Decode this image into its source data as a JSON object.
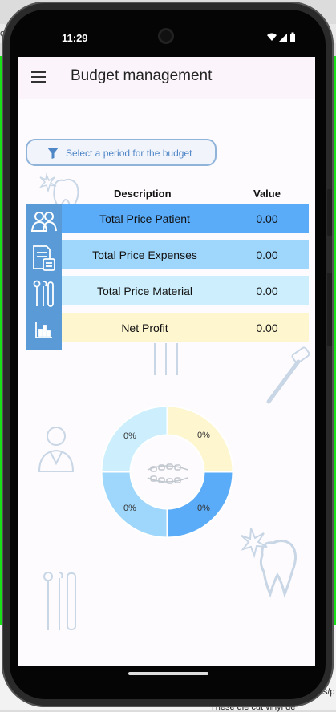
{
  "status_bar": {
    "time": "11:29"
  },
  "app_bar": {
    "title": "Budget management",
    "menu_icon": "hamburger-menu-icon"
  },
  "filter": {
    "label": "Select a period for the budget",
    "icon": "filter-icon"
  },
  "table": {
    "headers": {
      "description": "Description",
      "value": "Value"
    },
    "rows": [
      {
        "label": "Total Price Patient",
        "value": "0.00",
        "color": "#5aabf8",
        "icon": "patients-icon"
      },
      {
        "label": "Total Price Expenses",
        "value": "0.00",
        "color": "#9fd6fb",
        "icon": "expenses-invoice-icon"
      },
      {
        "label": "Total Price Material",
        "value": "0.00",
        "color": "#cdeffd",
        "icon": "dental-tools-icon"
      },
      {
        "label": "Net Profit",
        "value": "0.00",
        "color": "#fdf6cf",
        "icon": "chart-icon"
      }
    ]
  },
  "chart_data": {
    "type": "pie",
    "slices": [
      {
        "label": "0%",
        "value": 0,
        "color": "#fdf6cf"
      },
      {
        "label": "0%",
        "value": 0,
        "color": "#5aabf8"
      },
      {
        "label": "0%",
        "value": 0,
        "color": "#9fd6fb"
      },
      {
        "label": "0%",
        "value": 0,
        "color": "#cdeffd"
      }
    ]
  },
  "background_snippets": {
    "left_tab": "on",
    "right_tab": "hi",
    "right_line1": "it",
    "right_line2": "Pcs/p",
    "bottom_line": "These die cut vinyl de"
  }
}
